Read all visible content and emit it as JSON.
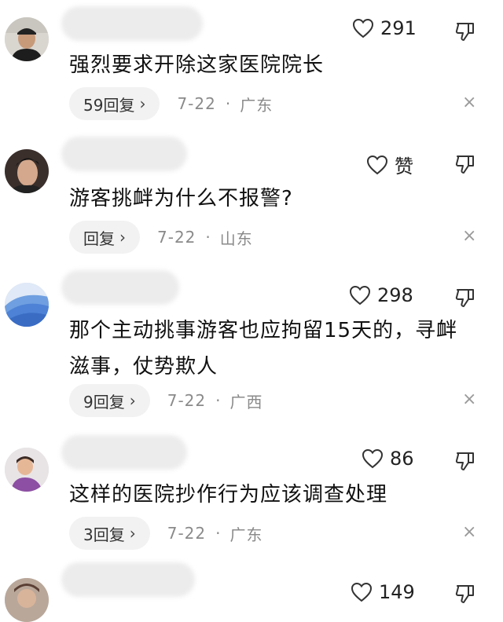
{
  "comments": [
    {
      "likes": "291",
      "text": "强烈要求开除这家医院院长",
      "reply": "59回复",
      "time": "7-22",
      "region": "广东",
      "partial_name": ""
    },
    {
      "likes": "赞",
      "text": "游客挑衅为什么不报警?",
      "reply": "回复",
      "time": "7-22",
      "region": "山东",
      "partial_name": ""
    },
    {
      "likes": "298",
      "text": "那个主动挑事游客也应拘留15天的，寻衅滋事，仗势欺人",
      "reply": "9回复",
      "time": "7-22",
      "region": "广西",
      "partial_name": ""
    },
    {
      "likes": "86",
      "text": "这样的医院抄作行为应该调查处理",
      "reply": "3回复",
      "time": "7-22",
      "region": "广东",
      "partial_name": ""
    },
    {
      "likes": "149",
      "text": "",
      "reply": "",
      "time": "",
      "region": "",
      "partial_name": ""
    }
  ],
  "ui": {
    "separator": "·",
    "chevron": "›",
    "close": "×"
  }
}
